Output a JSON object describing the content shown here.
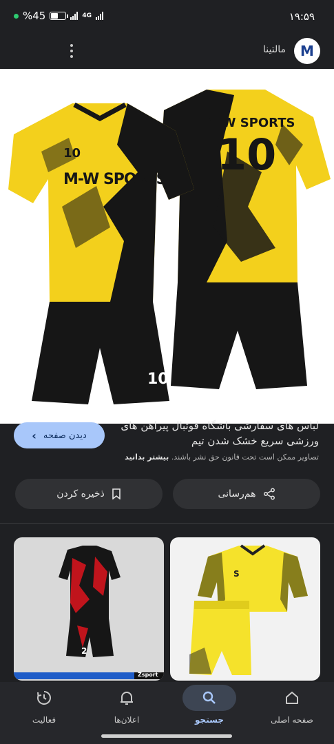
{
  "status_bar": {
    "battery_label": "%45",
    "battery_level": 0.45,
    "network_type": "4G",
    "time": "۱۹:۵۹"
  },
  "header": {
    "source_name": "مالتینا",
    "logo_letter": "M"
  },
  "hero": {
    "jersey_text": "M-W SPORTS",
    "number": "10",
    "colors": {
      "yellow": "#f3d01c",
      "black": "#161616"
    }
  },
  "details": {
    "title": "لباس های سفارشی باشگاه فوتبال پیراهن های ورزشی سریع خشک شدن تیم",
    "visit_label": "دیدن صفحه",
    "copyright_text": "تصاویر ممکن است تحت قانون حق نشر باشند.",
    "learn_more": "بیشتر بدانید",
    "share_label": "هم‌رسانی",
    "save_label": "ذخیره کردن"
  },
  "related": [
    {
      "number": "2",
      "brand": "Zsport",
      "colors": [
        "#c0141c",
        "#161616"
      ]
    },
    {
      "letter": "S",
      "colors": [
        "#f5e22b",
        "#222222"
      ]
    }
  ],
  "bottom_nav": {
    "items": [
      {
        "label": "صفحه اصلی",
        "icon": "home-icon"
      },
      {
        "label": "جستجو",
        "icon": "search-icon",
        "active": true
      },
      {
        "label": "اعلان‌ها",
        "icon": "bell-icon"
      },
      {
        "label": "فعالیت",
        "icon": "history-icon"
      }
    ]
  },
  "theme": {
    "accent": "#a8c7fa",
    "background": "#1f2023"
  }
}
